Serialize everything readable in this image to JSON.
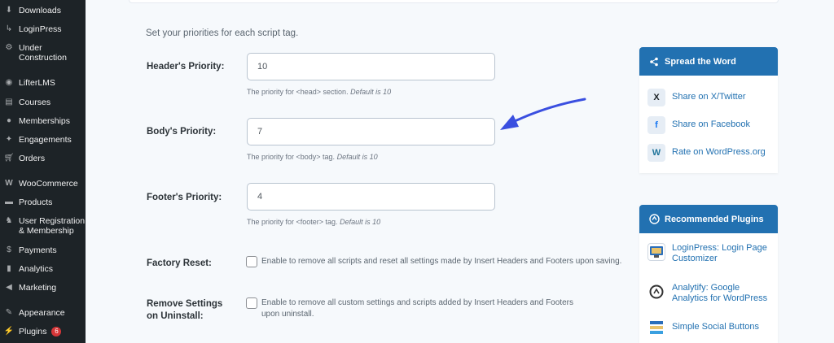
{
  "sidebar": {
    "items": [
      {
        "label": "Downloads",
        "icon": "downloads-icon"
      },
      {
        "label": "LoginPress",
        "icon": "loginpress-icon"
      },
      {
        "label": "Under Construction",
        "icon": "gear-icon"
      },
      {
        "label": "LifterLMS",
        "icon": "lifterlms-icon"
      },
      {
        "label": "Courses",
        "icon": "courses-icon"
      },
      {
        "label": "Memberships",
        "icon": "memberships-icon"
      },
      {
        "label": "Engagements",
        "icon": "engagements-icon"
      },
      {
        "label": "Orders",
        "icon": "cart-icon"
      },
      {
        "label": "WooCommerce",
        "icon": "woocommerce-icon"
      },
      {
        "label": "Products",
        "icon": "products-icon"
      },
      {
        "label": "User Registration & Membership",
        "icon": "user-registration-icon"
      },
      {
        "label": "Payments",
        "icon": "payments-icon"
      },
      {
        "label": "Analytics",
        "icon": "analytics-icon"
      },
      {
        "label": "Marketing",
        "icon": "megaphone-icon"
      },
      {
        "label": "Appearance",
        "icon": "paintbrush-icon"
      },
      {
        "label": "Plugins",
        "icon": "plugins-icon",
        "badge": "6"
      }
    ]
  },
  "main": {
    "intro": "Set your priorities for each script tag.",
    "header_priority": {
      "label": "Header's Priority:",
      "value": "10",
      "help": "The priority for <head> section.",
      "help_default": "Default is 10"
    },
    "body_priority": {
      "label": "Body's Priority:",
      "value": "7",
      "help": "The priority for <body> tag.",
      "help_default": "Default is 10"
    },
    "footer_priority": {
      "label": "Footer's Priority:",
      "value": "4",
      "help": "The priority for <footer> tag.",
      "help_default": "Default is 10"
    },
    "factory_reset": {
      "label": "Factory Reset:",
      "text": "Enable to remove all scripts and reset all settings made by Insert Headers and Footers upon saving."
    },
    "remove_settings": {
      "label": "Remove Settings on Uninstall:",
      "text": "Enable to remove all custom settings and scripts added by Insert Headers and Footers upon uninstall."
    }
  },
  "spread": {
    "title": "Spread the Word",
    "links": [
      {
        "label": "Share on X/Twitter",
        "icon": "x-twitter-icon"
      },
      {
        "label": "Share on Facebook",
        "icon": "facebook-icon"
      },
      {
        "label": "Rate on WordPress.org",
        "icon": "wordpress-icon"
      }
    ]
  },
  "recommended": {
    "title": "Recommended Plugins",
    "links": [
      {
        "label": "LoginPress: Login Page Customizer",
        "icon": "loginpress-plugin-icon"
      },
      {
        "label": "Analytify: Google Analytics for WordPress",
        "icon": "analytify-plugin-icon"
      },
      {
        "label": "Simple Social Buttons",
        "icon": "simple-social-buttons-icon"
      }
    ]
  },
  "colors": {
    "accent": "#2271b1",
    "sidebar": "#1d2327",
    "arrow": "#3a4fe0",
    "badge": "#d63638"
  }
}
